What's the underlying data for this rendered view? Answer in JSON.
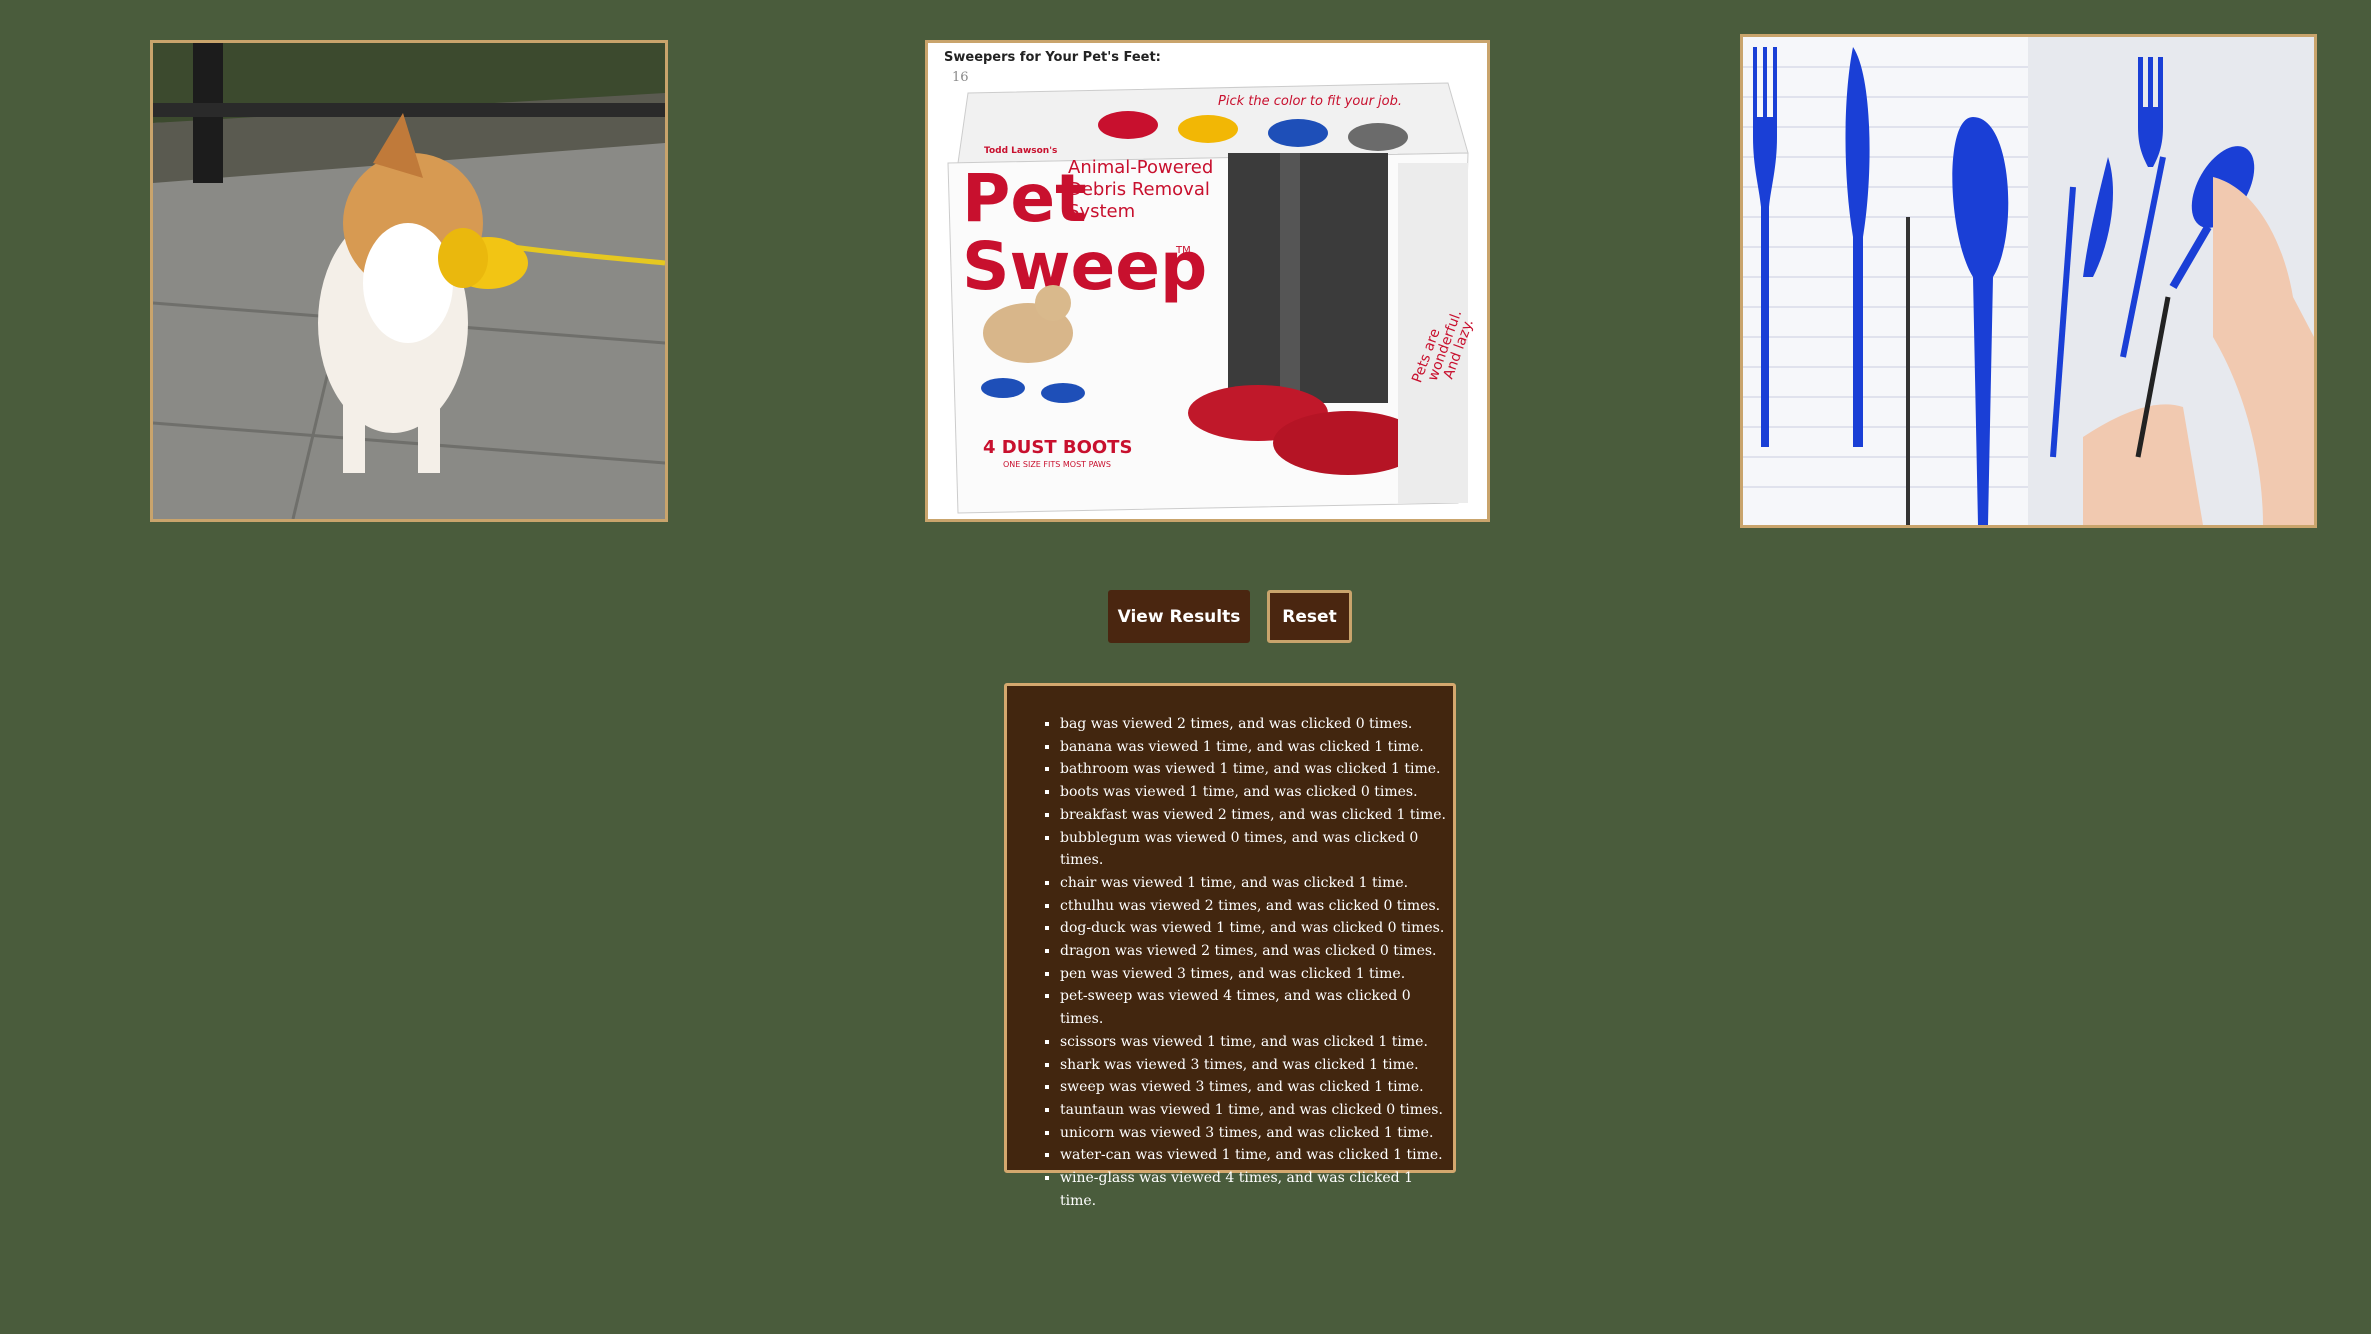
{
  "products": [
    {
      "id": "dog-duck",
      "icon": "dog-duck-image"
    },
    {
      "id": "pet-sweep",
      "icon": "pet-sweep-image",
      "caption": "Sweepers for Your Pet's Feet:",
      "page_number": "16",
      "brand": "Todd Lawson's",
      "title_line1": "Pet",
      "title_line2": "Sweep",
      "tm": "TM",
      "tagline1": "Animal-Powered",
      "tagline2": "Debris Removal",
      "tagline3": "System",
      "top_banner": "Pick the color to fit your job.",
      "boots_count": "4 DUST BOOTS",
      "boots_sub": "ONE SIZE FITS MOST PAWS",
      "side_text1": "Pets are",
      "side_text2": "wonderful.",
      "side_text3": "And lazy.",
      "colors": [
        "#c8102e",
        "#f2b705",
        "#1e4fb8",
        "#6b6b6b"
      ]
    },
    {
      "id": "pen",
      "icon": "pen-cutlery-image",
      "accent": "#1a3fd6"
    }
  ],
  "buttons": {
    "view_results": "View Results",
    "reset": "Reset"
  },
  "results": [
    "bag was viewed 2 times, and was clicked 0 times.",
    "banana was viewed 1 time, and was clicked 1 time.",
    "bathroom was viewed 1 time, and was clicked 1 time.",
    "boots was viewed 1 time, and was clicked 0 times.",
    "breakfast was viewed 2 times, and was clicked 1 time.",
    "bubblegum was viewed 0 times, and was clicked 0 times.",
    "chair was viewed 1 time, and was clicked 1 time.",
    "cthulhu was viewed 2 times, and was clicked 0 times.",
    "dog-duck was viewed 1 time, and was clicked 0 times.",
    "dragon was viewed 2 times, and was clicked 0 times.",
    "pen was viewed 3 times, and was clicked 1 time.",
    "pet-sweep was viewed 4 times, and was clicked 0 times.",
    "scissors was viewed 1 time, and was clicked 1 time.",
    "shark was viewed 3 times, and was clicked 1 time.",
    "sweep was viewed 3 times, and was clicked 1 time.",
    "tauntaun was viewed 1 time, and was clicked 0 times.",
    "unicorn was viewed 3 times, and was clicked 1 time.",
    "water-can was viewed 1 time, and was clicked 1 time.",
    "wine-glass was viewed 4 times, and was clicked 1 time."
  ]
}
